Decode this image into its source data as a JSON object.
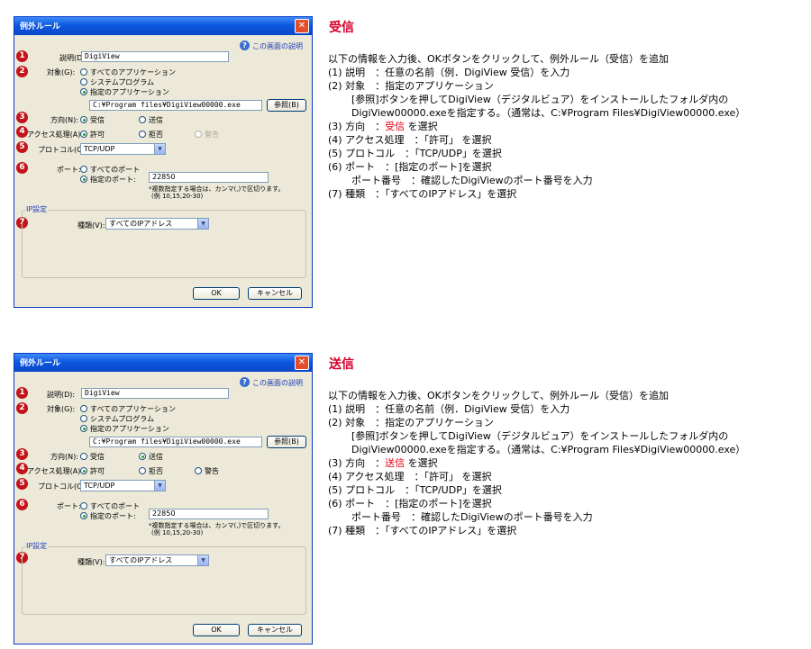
{
  "dialogs": [
    {
      "title": "例外ルール",
      "help_link": "この画面の説明",
      "label_description": "説明(D):",
      "description_value": "DigiView",
      "label_target": "対象(G):",
      "target_options": [
        "すべてのアプリケーション",
        "システムプログラム",
        "指定のアプリケーション"
      ],
      "target_selected": 2,
      "app_path": "C:¥Program files¥DigiView00000.exe",
      "browse_button": "参照(B)",
      "label_direction": "方向(N):",
      "direction_options": [
        "受信",
        "送信"
      ],
      "direction_selected": 0,
      "label_action": "アクセス処理(A):",
      "action_options": [
        "許可",
        "拒否",
        "警告"
      ],
      "action_selected": 0,
      "action_warn_disabled": true,
      "label_protocol": "プロトコル(C):",
      "protocol_value": "TCP/UDP",
      "label_port": "ポート:",
      "port_options": [
        "すべてのポート",
        "指定のポート:"
      ],
      "port_selected": 1,
      "port_value": "22850",
      "port_note_1": "*複数指定する場合は、カンマ(,)で区切ります。",
      "port_note_2": "(例 10,15,20-30)",
      "ip_group_title": "IP設定",
      "label_type": "種類(V):",
      "type_value": "すべてのIPアドレス",
      "ok_button": "OK",
      "cancel_button": "キャンセル",
      "markers": [
        "1",
        "2",
        "3",
        "4",
        "5",
        "6",
        "7"
      ]
    },
    {
      "title": "例外ルール",
      "help_link": "この画面の説明",
      "label_description": "説明(D):",
      "description_value": "DigiView",
      "label_target": "対象(G):",
      "target_options": [
        "すべてのアプリケーション",
        "システムプログラム",
        "指定のアプリケーション"
      ],
      "target_selected": 2,
      "app_path": "C:¥Program files¥DigiView00000.exe",
      "browse_button": "参照(B)",
      "label_direction": "方向(N):",
      "direction_options": [
        "受信",
        "送信"
      ],
      "direction_selected": 1,
      "label_action": "アクセス処理(A):",
      "action_options": [
        "許可",
        "拒否",
        "警告"
      ],
      "action_selected": 0,
      "action_warn_disabled": false,
      "label_protocol": "プロトコル(C):",
      "protocol_value": "TCP/UDP",
      "label_port": "ポート:",
      "port_options": [
        "すべてのポート",
        "指定のポート:"
      ],
      "port_selected": 1,
      "port_value": "22850",
      "port_note_1": "*複数指定する場合は、カンマ(,)で区切ります。",
      "port_note_2": "(例 10,15,20-30)",
      "ip_group_title": "IP設定",
      "label_type": "種類(V):",
      "type_value": "すべてのIPアドレス",
      "ok_button": "OK",
      "cancel_button": "キャンセル",
      "markers": [
        "1",
        "2",
        "3",
        "4",
        "5",
        "6",
        "7"
      ]
    }
  ],
  "sections": [
    {
      "heading": "受信",
      "intro": "以下の情報を入力後、OKボタンをクリックして、例外ルール（受信）を追加",
      "line1": "(1) 説明　：任意の名前（例．DigiView 受信）を入力",
      "line2": "(2) 対象　：指定のアプリケーション",
      "line2a": "[参照]ボタンを押してDigiView（デジタルビュア）をインストールしたフォルダ内の",
      "line2b": "DigiView00000.exeを指定する。（通常は、C:¥Program Files¥DigiView00000.exe）",
      "line3_prefix": "(3) 方向　：",
      "line3_value": "受信",
      "line3_suffix": " を選択",
      "line4": "(4) アクセス処理　：「許可」 を選択",
      "line5": "(5) プロトコル　：「TCP/UDP」を選択",
      "line6": "(6) ポート　：[指定のポート]を選択",
      "line6a": "ポート番号　：確認したDigiViewのポート番号を入力",
      "line7": "(7) 種類　：「すべてのIPアドレス」を選択"
    },
    {
      "heading": "送信",
      "intro": "以下の情報を入力後、OKボタンをクリックして、例外ルール（受信）を追加",
      "line1": "(1) 説明　：任意の名前（例．DigiView 受信）を入力",
      "line2": "(2) 対象　：指定のアプリケーション",
      "line2a": "[参照]ボタンを押してDigiView（デジタルビュア）をインストールしたフォルダ内の",
      "line2b": "DigiView00000.exeを指定する。（通常は、C:¥Program Files¥DigiView00000.exe）",
      "line3_prefix": "(3) 方向　：",
      "line3_value": "送信",
      "line3_suffix": " を選択",
      "line4": "(4) アクセス処理　：「許可」 を選択",
      "line5": "(5) プロトコル　：「TCP/UDP」を選択",
      "line6": "(6) ポート　：[指定のポート]を選択",
      "line6a": "ポート番号　：確認したDigiViewのポート番号を入力",
      "line7": "(7) 種類　：「すべてのIPアドレス」を選択"
    }
  ],
  "colors": {
    "heading": "#d4002a",
    "highlight": "#e60012",
    "marker": "#c4141b",
    "titlebar": "#0d58e0",
    "dialog_bg": "#ece9d8"
  },
  "icons": [
    "help-icon",
    "close-icon",
    "chevron-down-icon"
  ]
}
